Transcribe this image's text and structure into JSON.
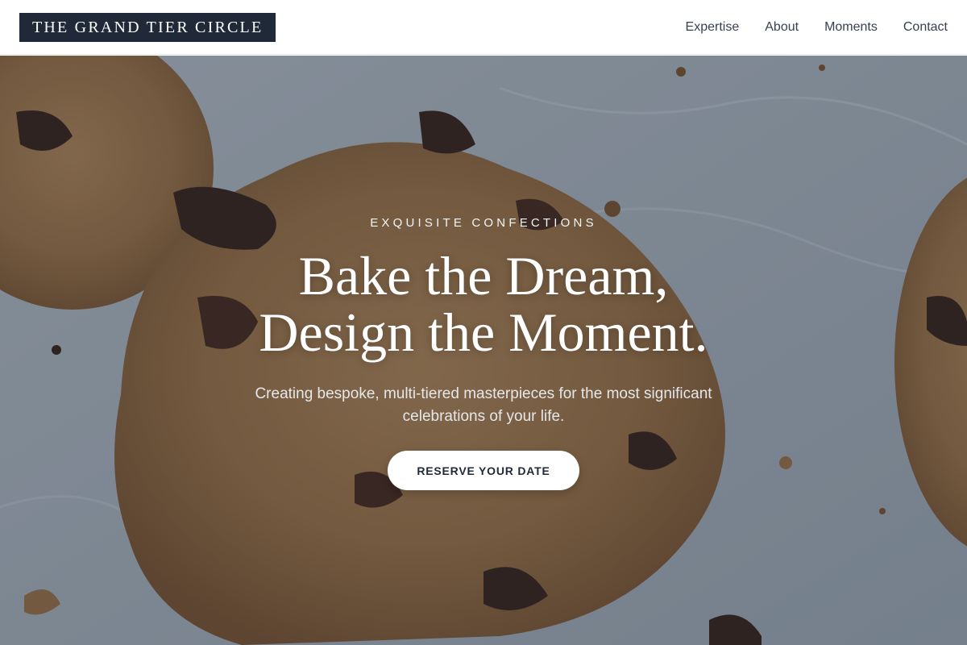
{
  "header": {
    "brand": "THE GRAND TIER CIRCLE",
    "nav": [
      {
        "label": "Expertise"
      },
      {
        "label": "About"
      },
      {
        "label": "Moments"
      },
      {
        "label": "Contact"
      }
    ]
  },
  "hero": {
    "eyebrow": "EXQUISITE CONFECTIONS",
    "headline_line1": "Bake the Dream,",
    "headline_line2": "Design the Moment.",
    "subtext": "Creating bespoke, multi-tiered masterpieces for the most significant celebrations of your life.",
    "cta_label": "RESERVE YOUR DATE",
    "background_image": "chocolate-chip-cookies-photo"
  },
  "colors": {
    "brand_bg": "#1f2937",
    "overlay": "#1f2937",
    "cta_bg": "#ffffff",
    "cta_text": "#1f2937",
    "nav_text": "#374151"
  }
}
